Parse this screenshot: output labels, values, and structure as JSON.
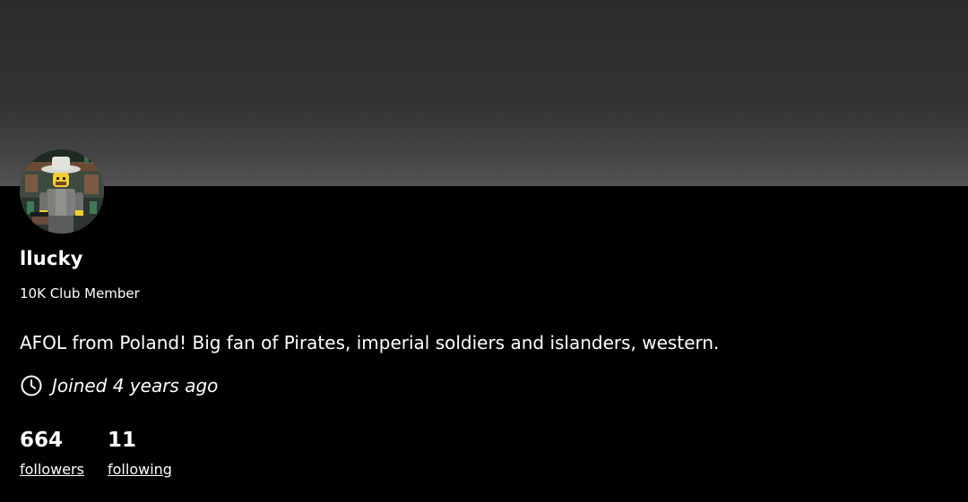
{
  "profile": {
    "username": "llucky",
    "badge": "10K Club Member",
    "bio": "AFOL from Poland! Big fan of Pirates, imperial soldiers and islanders, western.",
    "joined": "Joined 4 years ago",
    "avatar_icon": "minifigure-avatar"
  },
  "stats": {
    "followers": {
      "count": "664",
      "label": "followers"
    },
    "following": {
      "count": "11",
      "label": "following"
    }
  },
  "colors": {
    "background": "#000000",
    "cover_gradient_top": "#2b2b2b",
    "cover_gradient_bottom": "#555555",
    "text": "#ffffff"
  }
}
